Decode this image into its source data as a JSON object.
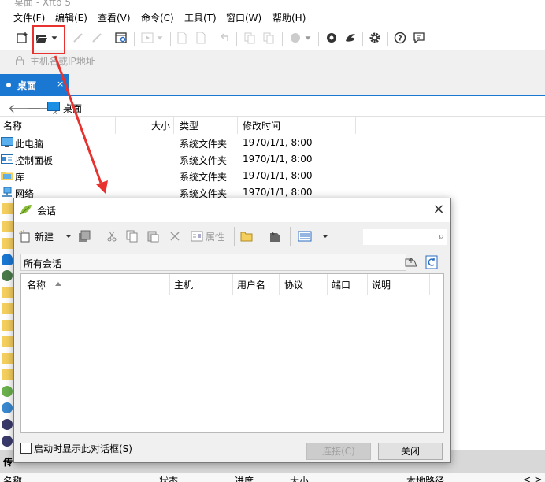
{
  "app": {
    "title_partial": "桌面 - Xftp 5"
  },
  "menu": [
    "文件(F)",
    "编辑(E)",
    "查看(V)",
    "命令(C)",
    "工具(T)",
    "窗口(W)",
    "帮助(H)"
  ],
  "host_placeholder": "主机名或IP地址",
  "tab": {
    "label": "桌面",
    "close": "×"
  },
  "path": {
    "location": "桌面"
  },
  "file_columns": {
    "name": "名称",
    "size": "大小",
    "type": "类型",
    "modified": "修改时间"
  },
  "files": [
    {
      "name": "此电脑",
      "type": "系统文件夹",
      "modified": "1970/1/1, 8:00"
    },
    {
      "name": "控制面板",
      "type": "系统文件夹",
      "modified": "1970/1/1, 8:00"
    },
    {
      "name": "库",
      "type": "系统文件夹",
      "modified": "1970/1/1, 8:00"
    },
    {
      "name": "网络",
      "type": "系统文件夹",
      "modified": "1970/1/1, 8:00"
    }
  ],
  "bottom": {
    "tab_partial": "传",
    "columns": {
      "name": "名称",
      "status": "状态",
      "progress": "进度",
      "size": "大小",
      "local_path": "本地路径",
      "arrow": "<->"
    }
  },
  "dialog": {
    "title": "会话",
    "close": "×",
    "toolbar": {
      "new": "新建",
      "properties": "属性"
    },
    "folder": "所有会话",
    "columns": {
      "name": "名称",
      "host": "主机",
      "user": "用户名",
      "protocol": "协议",
      "port": "端口",
      "desc": "说明"
    },
    "show_on_startup": "启动时显示此对话框(S)",
    "connect": "连接(C)",
    "close_button": "关闭"
  },
  "colors": {
    "accent": "#1a77d2",
    "highlight": "#e8322f"
  }
}
